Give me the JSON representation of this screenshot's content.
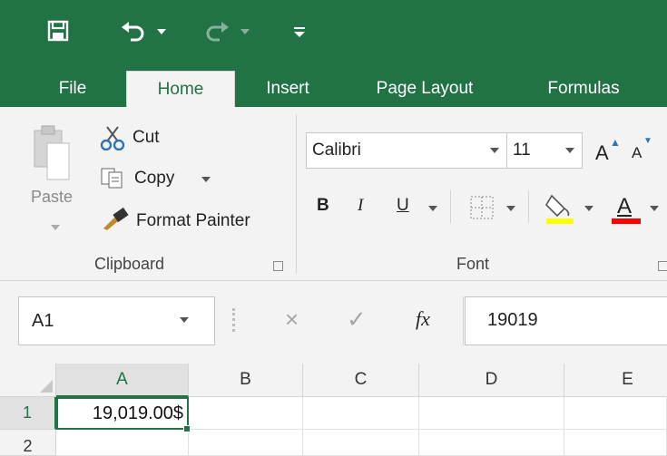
{
  "quick_access": {
    "save_icon": "save-icon",
    "undo_icon": "undo-icon",
    "redo_icon": "redo-icon",
    "customize_icon": "customize-qat-icon"
  },
  "tabs": [
    {
      "label": "File",
      "active": false
    },
    {
      "label": "Home",
      "active": true
    },
    {
      "label": "Insert",
      "active": false
    },
    {
      "label": "Page Layout",
      "active": false
    },
    {
      "label": "Formulas",
      "active": false
    }
  ],
  "clipboard": {
    "paste_label": "Paste",
    "cut_label": "Cut",
    "copy_label": "Copy",
    "format_painter_label": "Format Painter",
    "group_label": "Clipboard"
  },
  "font": {
    "font_name": "Calibri",
    "font_size": "11",
    "bold_label": "B",
    "italic_label": "I",
    "underline_label": "U",
    "grow_label": "A",
    "shrink_label": "A",
    "font_color_label": "A",
    "group_label": "Font",
    "highlight_color": "#ffff00",
    "font_color": "#ff0000"
  },
  "formula_bar": {
    "name_box": "A1",
    "cancel_icon": "×",
    "enter_icon": "✓",
    "fx_label": "fx",
    "formula": "19019"
  },
  "grid": {
    "columns": [
      "A",
      "B",
      "C",
      "D",
      "E"
    ],
    "rows": [
      "1",
      "2"
    ],
    "a1_value": "19,019.00$"
  },
  "colors": {
    "accent": "#217346",
    "ribbon_bg": "#f3f3f3"
  }
}
